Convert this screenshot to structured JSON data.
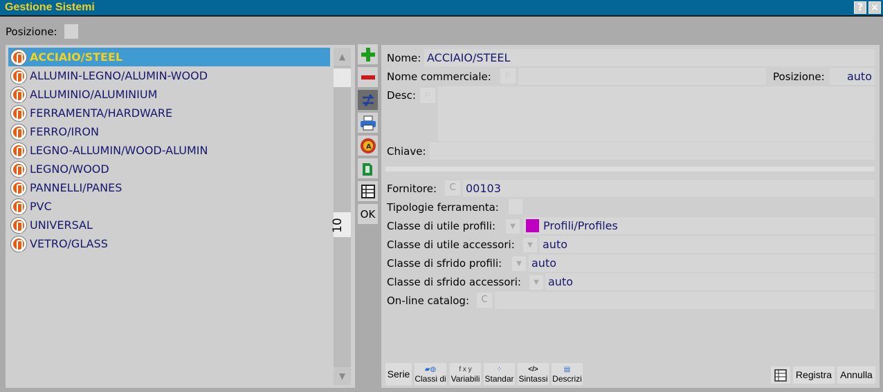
{
  "window": {
    "title": "Gestione Sistemi",
    "help_glyph": "?",
    "close_glyph": "×"
  },
  "top": {
    "posizione_label": "Posizione:"
  },
  "list": {
    "items": [
      {
        "label": "ACCIAIO/STEEL",
        "selected": true
      },
      {
        "label": "ALLUMIN-LEGNO/ALUMIN-WOOD"
      },
      {
        "label": "ALLUMINIO/ALUMINIUM"
      },
      {
        "label": "FERRAMENTA/HARDWARE"
      },
      {
        "label": "FERRO/IRON"
      },
      {
        "label": "LEGNO-ALLUMIN/WOOD-ALUMIN"
      },
      {
        "label": "LEGNO/WOOD"
      },
      {
        "label": "PANNELLI/PANES"
      },
      {
        "label": "PVC"
      },
      {
        "label": "UNIVERSAL"
      },
      {
        "label": "VETRO/GLASS"
      }
    ],
    "count": "10"
  },
  "toolbar": {
    "add_icon": "plus-icon",
    "remove_icon": "minus-icon",
    "swap_icon": "swap-icon",
    "print_icon": "printer-icon",
    "alert_icon": "alert-icon",
    "export_icon": "export-icon",
    "grid_icon": "grid-icon",
    "ok_label": "OK"
  },
  "form": {
    "nome_label": "Nome:",
    "nome_value": "ACCIAIO/STEEL",
    "nome_comm_label": "Nome commerciale:",
    "nome_comm_value": "",
    "posizione_label": "Posizione:",
    "posizione_value": "auto",
    "desc_label": "Desc:",
    "desc_value": "",
    "chiave_label": "Chiave:",
    "chiave_value": "",
    "fornitore_label": "Fornitore:",
    "fornitore_btn": "C",
    "fornitore_value": "00103",
    "tipologie_label": "Tipologie ferramenta:",
    "classe_utile_prof_label": "Classe di utile profili:",
    "classe_utile_prof_value": "Profili/Profiles",
    "classe_utile_prof_color": "#c000c0",
    "classe_utile_acc_label": "Classe di utile accessori:",
    "classe_utile_acc_value": "auto",
    "classe_sfrido_prof_label": "Classe di sfrido profili:",
    "classe_sfrido_prof_value": "auto",
    "classe_sfrido_acc_label": "Classe di sfrido accessori:",
    "classe_sfrido_acc_value": "auto",
    "online_label": "On-line catalog:",
    "online_btn": "C",
    "online_value": ""
  },
  "bottom": {
    "serie": "Serie",
    "classi": "Classi di",
    "variabili": "Variabili",
    "standar": "Standar",
    "sintassi": "Sintassi",
    "descrizi": "Descrizi",
    "registra": "Registra",
    "annulla": "Annulla"
  }
}
